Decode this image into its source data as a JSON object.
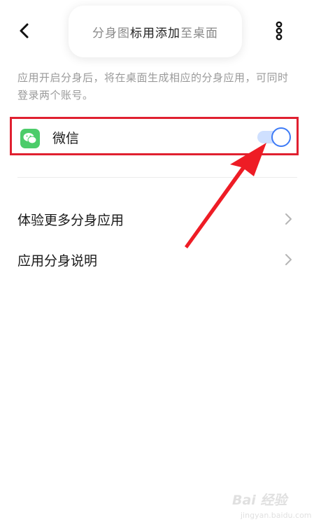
{
  "header": {
    "toast_text_back": "分身图标已添加至桌面",
    "toast_text_front": "标用添加"
  },
  "description": "应用开启分身后，将在桌面生成相应的分身应用，可同时登录两个账号。",
  "apps": [
    {
      "name": "微信",
      "icon": "wechat-icon",
      "toggle_on": true
    }
  ],
  "menu": [
    {
      "label": "体验更多分身应用"
    },
    {
      "label": "应用分身说明"
    }
  ],
  "colors": {
    "accent": "#3e7bf6",
    "wechat": "#4ccc6a",
    "annotation": "#e02030"
  },
  "watermark": {
    "brand": "Bai 经验",
    "url": "jingyan.baidu.com"
  }
}
